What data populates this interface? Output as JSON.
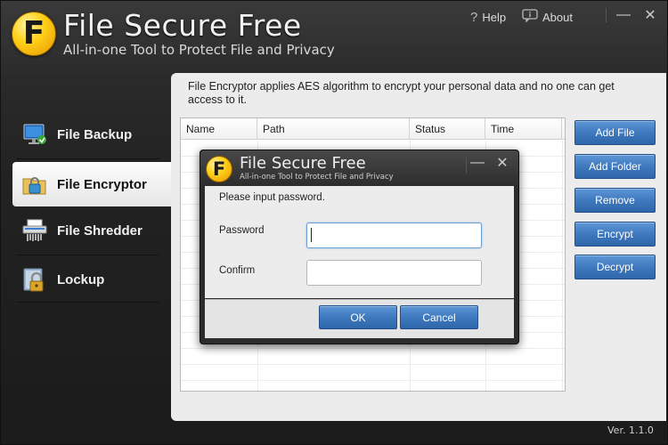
{
  "app": {
    "logo_letter": "F",
    "title": "File Secure Free",
    "subtitle": "All-in-one Tool to Protect File and Privacy",
    "help_label": "Help",
    "about_label": "About",
    "minimize_glyph": "—",
    "close_glyph": "✕",
    "version": "Ver. 1.1.0"
  },
  "sidebar": {
    "items": [
      {
        "label": "File Backup",
        "icon": "monitor-icon",
        "active": false
      },
      {
        "label": "File Encryptor",
        "icon": "lock-folder-icon",
        "active": true
      },
      {
        "label": "File Shredder",
        "icon": "shredder-icon",
        "active": false
      },
      {
        "label": "Lockup",
        "icon": "padlock-icon",
        "active": false
      }
    ]
  },
  "main": {
    "description": "File Encryptor applies AES algorithm to encrypt your personal data and no one can get access to it.",
    "table": {
      "columns": [
        "Name",
        "Path",
        "Status",
        "Time"
      ],
      "rows": []
    },
    "actions": [
      "Add File",
      "Add Folder",
      "Remove",
      "Encrypt",
      "Decrypt"
    ]
  },
  "dialog": {
    "logo_letter": "F",
    "title": "File Secure Free",
    "subtitle": "All-in-one Tool to Protect File and Privacy",
    "minimize_glyph": "—",
    "close_glyph": "✕",
    "prompt": "Please input password.",
    "password_label": "Password",
    "password_value": "",
    "confirm_label": "Confirm",
    "confirm_value": "",
    "ok_label": "OK",
    "cancel_label": "Cancel"
  },
  "colors": {
    "accent_button": "#3f79be",
    "logo_yellow": "#ffd21a",
    "chrome_dark": "#2a2a2a"
  }
}
